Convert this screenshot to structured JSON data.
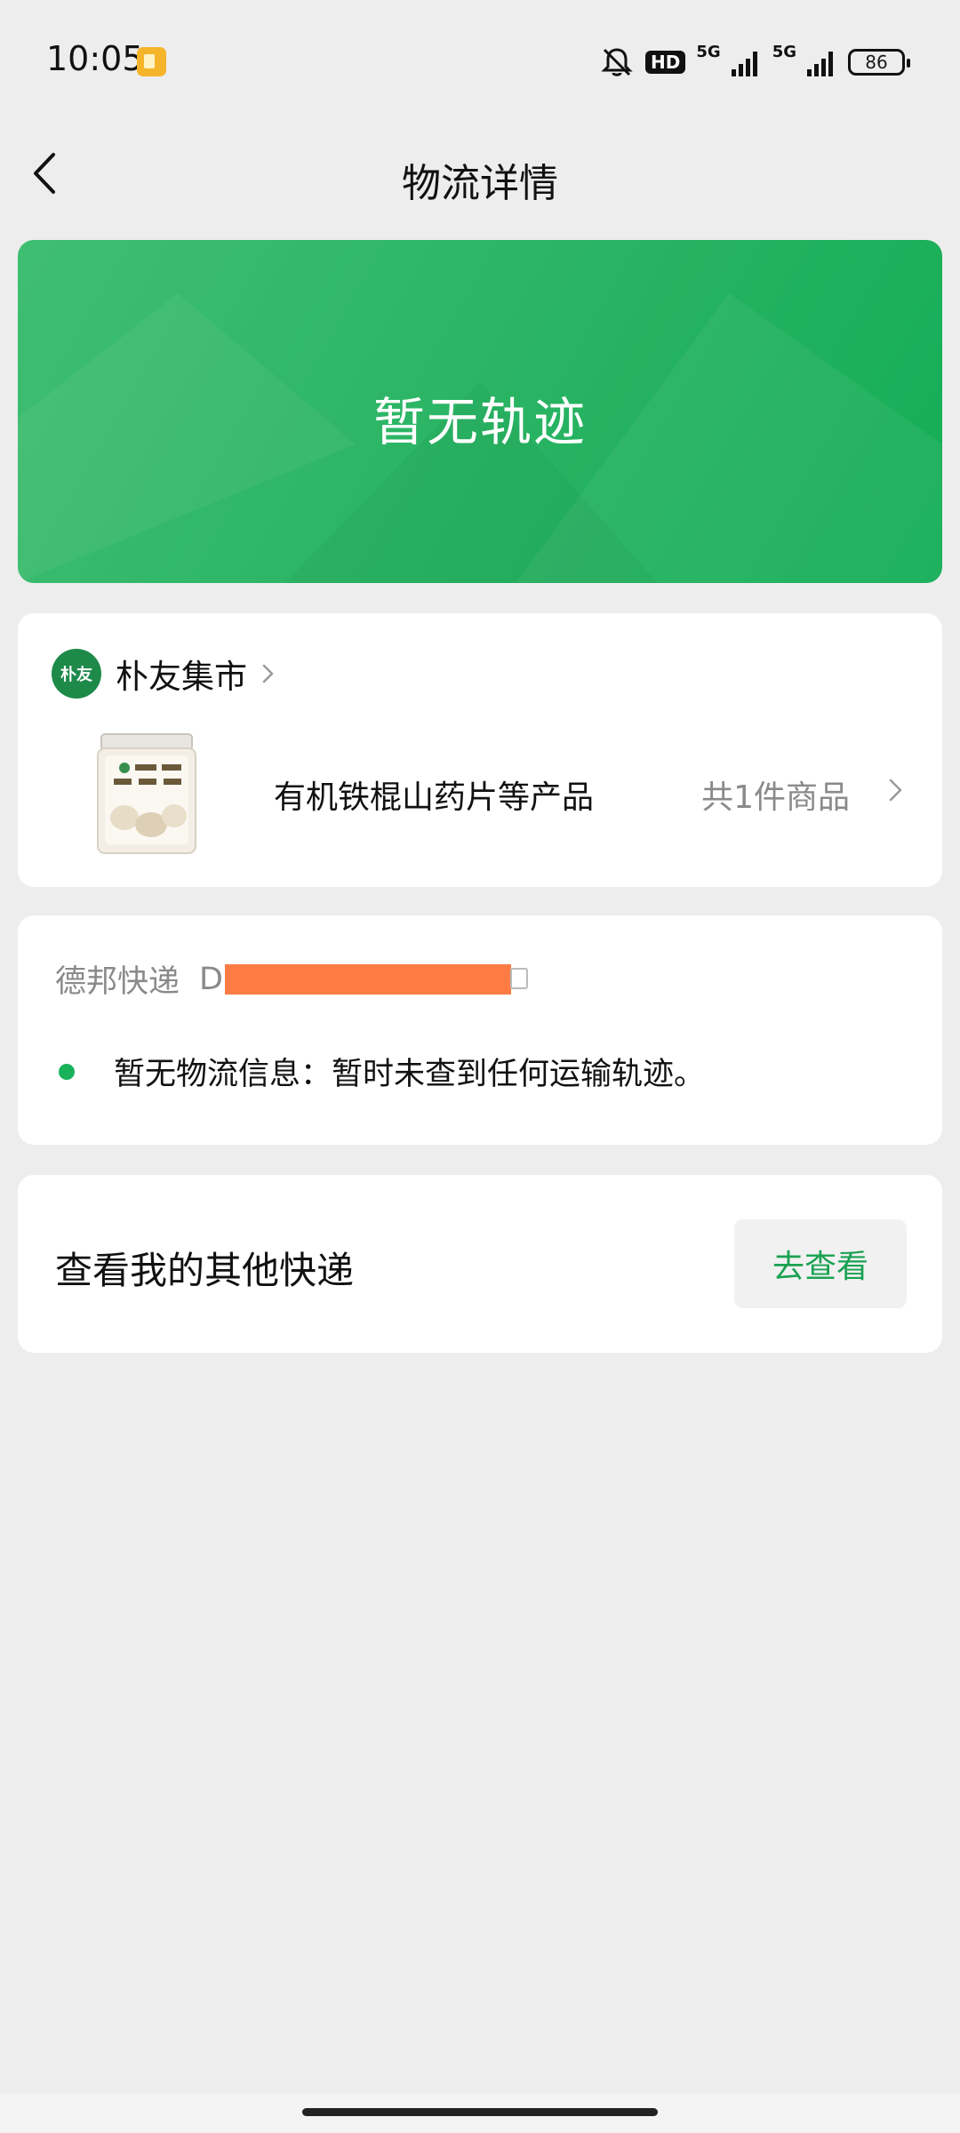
{
  "status_bar": {
    "time": "10:05",
    "hd_label": "HD",
    "net1": "5G",
    "net2": "5G",
    "battery": "86",
    "icons": [
      "app-notification-icon",
      "mute-bell-icon",
      "hd-icon",
      "signal-icon",
      "signal-icon",
      "battery-icon"
    ]
  },
  "nav": {
    "title": "物流详情",
    "back_icon": "chevron-left-icon"
  },
  "banner": {
    "text": "暂无轨迹",
    "color_start": "#3fbe71",
    "color_end": "#14ad56"
  },
  "shop": {
    "logo_text": "朴友",
    "name": "朴友集市",
    "product_name": "有机铁棍山药片等产品",
    "product_count": "共1件商品"
  },
  "logistics": {
    "courier": "德邦快递",
    "tracking_prefix": "D",
    "status_text": "暂无物流信息：暂时未查到任何运输轨迹。",
    "dot_color": "#19b25a"
  },
  "other": {
    "title": "查看我的其他快递",
    "button_label": "去查看",
    "button_color": "#1aa152"
  }
}
